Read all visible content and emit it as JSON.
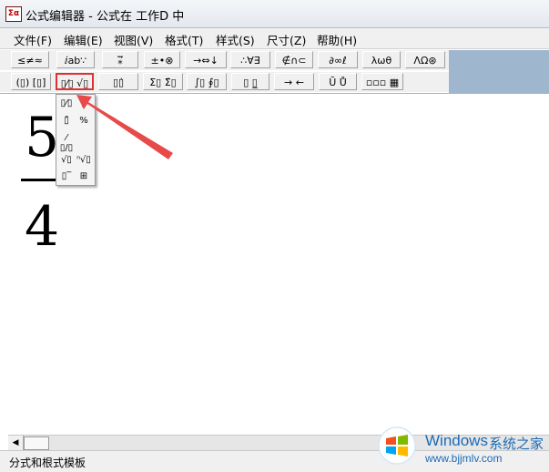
{
  "window": {
    "title": "公式编辑器 - 公式在 工作D 中",
    "app_icon_glyph": "Σα"
  },
  "menu": [
    "文件(F)",
    "编辑(E)",
    "视图(V)",
    "格式(T)",
    "样式(S)",
    "尺寸(Z)",
    "帮助(H)"
  ],
  "toolbar": {
    "row1": [
      "≤≠≈",
      "ⅈab∵",
      "⁎⃗⃛",
      "±•⊗",
      "→⇔↓",
      "∴∀∃",
      "∉∩⊂",
      "∂∞ℓ",
      "λωθ",
      "ΛΩ⊛"
    ],
    "row2": [
      "(▯) [▯]",
      "▯⁄▯ √▯",
      "▯▯̇",
      "Σ▯ Σ̂▯",
      "∫▯ ∮▯",
      "▯ ▯̲",
      "→ ←",
      "Ū Ů",
      "▫▫▫ ▦"
    ]
  },
  "palette": [
    "▯⁄▯",
    "▮",
    "▯̄",
    "⁄",
    "%",
    "▯/▯",
    "√▯",
    "ⁿ√▯",
    "▯‾",
    "⊞"
  ],
  "document": {
    "numerator": "5",
    "denominator": "4"
  },
  "status": "分式和根式模板",
  "watermark": {
    "brand": "Windows",
    "subtitle": "系统之家",
    "url": "www.bjjmlv.com"
  },
  "colors": {
    "highlight": "#e03030",
    "arrow": "#e84a4a",
    "watermark": "#1c6cb5"
  }
}
